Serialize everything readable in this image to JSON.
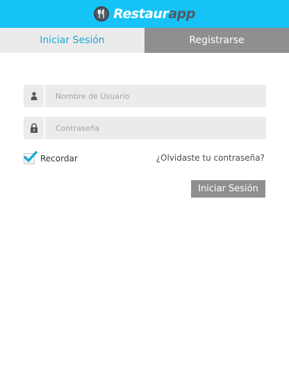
{
  "header": {
    "logo_text_main": "Restaur",
    "logo_text_accent": "app",
    "logo_icon": "fork-knife-icon",
    "brand_color": "#15c3f6"
  },
  "tabs": [
    {
      "label": "Iniciar Sesión",
      "active": true
    },
    {
      "label": "Registrarse",
      "active": false
    }
  ],
  "form": {
    "username": {
      "placeholder": "Nombre de Usuario",
      "value": "",
      "icon": "user-icon"
    },
    "password": {
      "placeholder": "Contraseña",
      "value": "",
      "icon": "lock-icon"
    },
    "remember": {
      "label": "Recordar",
      "checked": true
    },
    "forgot_label": "¿Olvidaste tu contraseña?",
    "submit_label": "Iniciar Sesión"
  }
}
